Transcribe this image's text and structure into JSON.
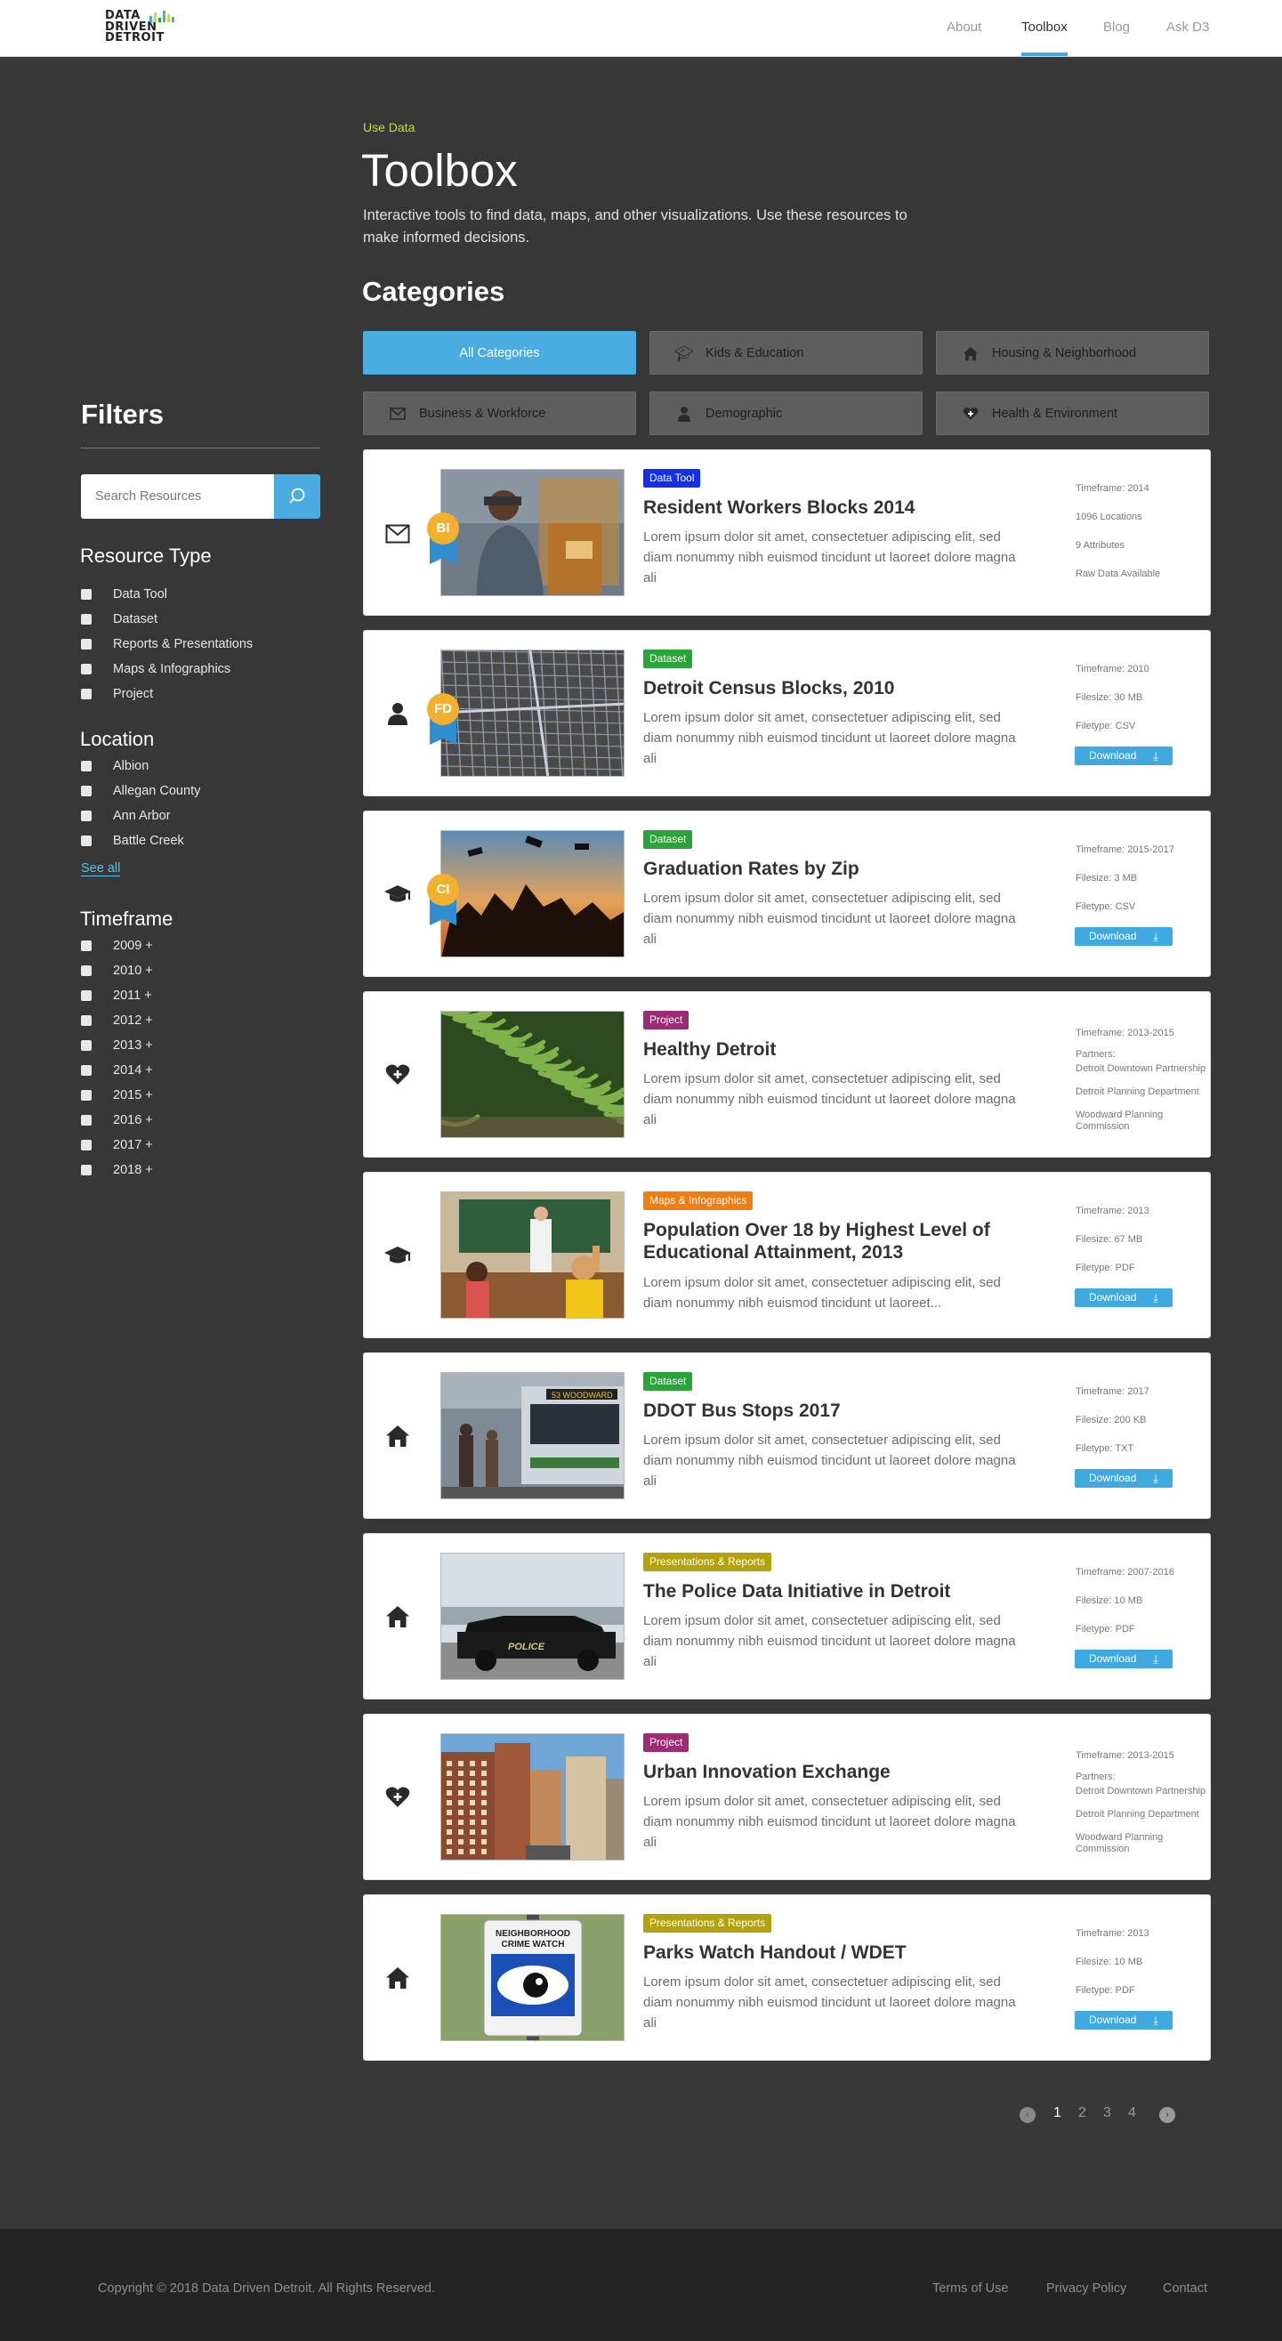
{
  "header": {
    "logo_lines": [
      "DATA",
      "DRIVEN",
      "DETROIT"
    ],
    "nav": [
      "About",
      "Toolbox",
      "Blog",
      "Ask D3"
    ],
    "active_nav": "Toolbox"
  },
  "hero": {
    "breadcrumb": "Use Data",
    "title": "Toolbox",
    "intro": "Interactive tools to find data, maps, and other visualizations. Use these resources to make informed decisions."
  },
  "categories": {
    "title": "Categories",
    "items": [
      {
        "label": "All Categories",
        "icon": "none",
        "active": true
      },
      {
        "label": "Kids & Education",
        "icon": "graduation-cap-icon"
      },
      {
        "label": "Housing & Neighborhood",
        "icon": "house-icon"
      },
      {
        "label": "Business & Workforce",
        "icon": "envelope-icon"
      },
      {
        "label": "Demographic",
        "icon": "person-icon"
      },
      {
        "label": "Health & Environment",
        "icon": "heart-plus-icon"
      }
    ]
  },
  "filters": {
    "title": "Filters",
    "search_placeholder": "Search Resources",
    "resource_type": {
      "title": "Resource Type",
      "items": [
        "Data Tool",
        "Dataset",
        "Reports & Presentations",
        "Maps & Infographics",
        "Project"
      ]
    },
    "location": {
      "title": "Location",
      "items": [
        "Albion",
        "Allegan County",
        "Ann Arbor",
        "Battle Creek"
      ],
      "see_all": "See all"
    },
    "timeframe": {
      "title": "Timeframe",
      "items": [
        "2009 +",
        "2010 +",
        "2011 +",
        "2012 +",
        "2013 +",
        "2014 +",
        "2015 +",
        "2016 +",
        "2017 +",
        "2018 +"
      ]
    }
  },
  "resources": [
    {
      "category_icon": "envelope-icon",
      "badge": "BI",
      "tag": "Data Tool",
      "tag_color": "#1430e6",
      "title": "Resident Workers Blocks 2014",
      "desc": "Lorem ipsum dolor sit amet, consectetuer adipiscing elit, sed diam nonummy nibh euismod tincidunt ut laoreet dolore magna ali",
      "meta": [
        "Timeframe: 2014",
        "1096 Locations",
        "9 Attributes",
        "Raw Data Available"
      ],
      "download": null,
      "thumb": "worker"
    },
    {
      "category_icon": "person-icon",
      "badge": "FD",
      "tag": "Dataset",
      "tag_color": "#2aa33b",
      "title": "Detroit Census Blocks, 2010",
      "desc": "Lorem ipsum dolor sit amet, consectetuer adipiscing elit, sed diam nonummy nibh euismod tincidunt ut laoreet dolore magna ali",
      "meta": [
        "Timeframe: 2010",
        "Filesize: 30 MB",
        "Filetype: CSV"
      ],
      "download": "Download",
      "thumb": "map"
    },
    {
      "category_icon": "graduation-cap-icon",
      "badge": "CI",
      "tag": "Dataset",
      "tag_color": "#2aa33b",
      "title": "Graduation Rates by Zip",
      "desc": "Lorem ipsum dolor sit amet, consectetuer adipiscing elit, sed diam nonummy nibh euismod tincidunt ut laoreet dolore magna ali",
      "meta": [
        "Timeframe: 2015-2017",
        "Filesize: 3 MB",
        "Filetype: CSV"
      ],
      "download": "Download",
      "thumb": "graduation"
    },
    {
      "category_icon": "heart-plus-icon",
      "badge": null,
      "tag": "Project",
      "tag_color": "#9b2c73",
      "title": "Healthy Detroit",
      "desc": "Lorem ipsum dolor sit amet, consectetuer adipiscing elit, sed diam nonummy nibh euismod tincidunt ut laoreet dolore magna ali",
      "meta": [
        "Timeframe: 2013-2015",
        "Partners:",
        "Detroit Downtown Partnership",
        "Detroit Planning Department",
        "Woodward Planning Commission"
      ],
      "download": null,
      "thumb": "beans"
    },
    {
      "category_icon": "graduation-cap-icon",
      "badge": null,
      "tag": "Maps & Infographics",
      "tag_color": "#ef7d12",
      "title": "Population Over 18 by Highest Level of Educational Attainment, 2013",
      "desc": "Lorem ipsum dolor sit amet, consectetuer adipiscing elit, sed diam nonummy nibh euismod tincidunt ut laoreet...",
      "meta": [
        "Timeframe: 2013",
        "Filesize: 67 MB",
        "Filetype: PDF"
      ],
      "download": "Download",
      "thumb": "classroom"
    },
    {
      "category_icon": "house-icon",
      "badge": null,
      "tag": "Dataset",
      "tag_color": "#2aa33b",
      "title": "DDOT Bus Stops 2017",
      "desc": "Lorem ipsum dolor sit amet, consectetuer adipiscing elit, sed diam nonummy nibh euismod tincidunt ut laoreet dolore magna ali",
      "meta": [
        "Timeframe: 2017",
        "Filesize: 200 KB",
        "Filetype: TXT"
      ],
      "download": "Download",
      "thumb": "bus"
    },
    {
      "category_icon": "house-icon",
      "badge": null,
      "tag": "Presentations & Reports",
      "tag_color": "#b3a10e",
      "title": "The Police Data Initiative in Detroit",
      "desc": "Lorem ipsum dolor sit amet, consectetuer adipiscing elit, sed diam nonummy nibh euismod tincidunt ut laoreet dolore magna ali",
      "meta": [
        "Timeframe: 2007-2016",
        "Filesize: 10 MB",
        "Filetype: PDF"
      ],
      "download": "Download",
      "thumb": "police"
    },
    {
      "category_icon": "heart-plus-icon",
      "badge": null,
      "tag": "Project",
      "tag_color": "#9b2c73",
      "title": "Urban Innovation Exchange",
      "desc": "Lorem ipsum dolor sit amet, consectetuer adipiscing elit, sed diam nonummy nibh euismod tincidunt ut laoreet dolore magna ali",
      "meta": [
        "Timeframe: 2013-2015",
        "Partners:",
        "Detroit Downtown Partnership",
        "Detroit Planning Department",
        "Woodward Planning Commission"
      ],
      "download": null,
      "thumb": "city"
    },
    {
      "category_icon": "house-icon",
      "badge": null,
      "tag": "Presentations & Reports",
      "tag_color": "#b3a10e",
      "title": "Parks Watch Handout / WDET",
      "desc": "Lorem ipsum dolor sit amet, consectetuer adipiscing elit, sed diam nonummy nibh euismod tincidunt ut laoreet dolore magna ali",
      "meta": [
        "Timeframe: 2013",
        "Filesize: 10 MB",
        "Filetype: PDF"
      ],
      "download": "Download",
      "thumb": "sign",
      "sign_text": [
        "NEIGHBORHOOD",
        "CRIME WATCH"
      ]
    }
  ],
  "pagination": {
    "pages": [
      "1",
      "2",
      "3",
      "4"
    ],
    "current": "1"
  },
  "footer": {
    "copyright": "Copyright © 2018 Data Driven Detroit. All Rights Reserved.",
    "links": [
      "Terms of Use",
      "Privacy Policy",
      "Contact"
    ]
  },
  "colors": {
    "accent": "#3fa9e0",
    "background": "#373737",
    "footer": "#242424",
    "breadcrumb": "#c8dc3c"
  }
}
